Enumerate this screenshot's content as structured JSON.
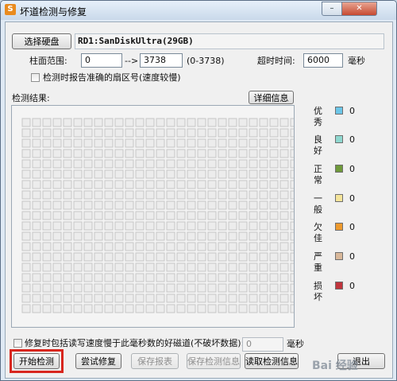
{
  "window": {
    "title": "坏道检测与修复",
    "app_icon": "S",
    "minimize_glyph": "–",
    "close_glyph": "✕"
  },
  "disk": {
    "select_button": "选择硬盘",
    "selected_disk": "RD1:SanDiskUltra(29GB)"
  },
  "range": {
    "label": "柱面范围:",
    "from": "0",
    "arrow": "-->",
    "to": "3738",
    "hint": "(0-3738)"
  },
  "timeout": {
    "label": "超时时间:",
    "value": "6000",
    "unit": "毫秒"
  },
  "options": {
    "report_sector": "检测时报告准确的扇区号(速度较慢)",
    "include_slow": "修复时包括读写速度慢于此毫秒数的好磁道(不破坏数据):",
    "slow_value": "0",
    "slow_unit": "毫秒"
  },
  "results": {
    "label": "检测结果:",
    "detail_button": "详细信息",
    "grid_cols": 27,
    "grid_rows": 19
  },
  "legend": [
    {
      "label": "优秀",
      "count": "0",
      "color": "#6cc6e8"
    },
    {
      "label": "良好",
      "count": "0",
      "color": "#8fd8cf"
    },
    {
      "label": "正常",
      "count": "0",
      "color": "#6f9a3a"
    },
    {
      "label": "一般",
      "count": "0",
      "color": "#f5e59a"
    },
    {
      "label": "欠佳",
      "count": "0",
      "color": "#ee9a2e"
    },
    {
      "label": "严重",
      "count": "0",
      "color": "#d9b89a"
    },
    {
      "label": "损坏",
      "count": "0",
      "color": "#c0353d"
    }
  ],
  "buttons": {
    "start": "开始检测",
    "try_repair": "尝试修复",
    "save_report": "保存报表",
    "save_info": "保存检测信息",
    "read_info": "读取检测信息",
    "exit": "退出"
  },
  "watermark": "Bai 经验"
}
